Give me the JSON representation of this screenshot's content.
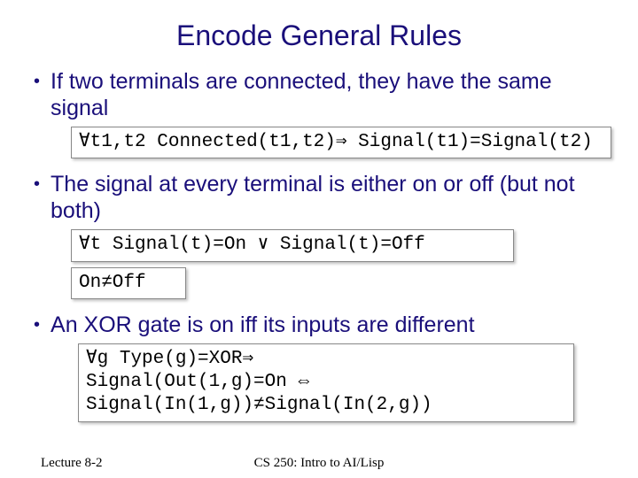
{
  "title": "Encode General Rules",
  "bullets": [
    "If two terminals are connected, they have the same signal",
    "The signal at every terminal is either on or off (but not both)",
    "An XOR gate is on iff its inputs are different"
  ],
  "formulas": {
    "f1": "∀t1,t2 Connected(t1,t2)⇒ Signal(t1)=Signal(t2)",
    "f2": "∀t Signal(t)=On ∨ Signal(t)=Off",
    "f3": "On≠Off",
    "f4": "∀g Type(g)=XOR⇒\nSignal(Out(1,g)=On ⇔\nSignal(In(1,g))≠Signal(In(2,g))"
  },
  "footer": {
    "left": "Lecture 8-2",
    "center": "CS 250: Intro to AI/Lisp"
  }
}
